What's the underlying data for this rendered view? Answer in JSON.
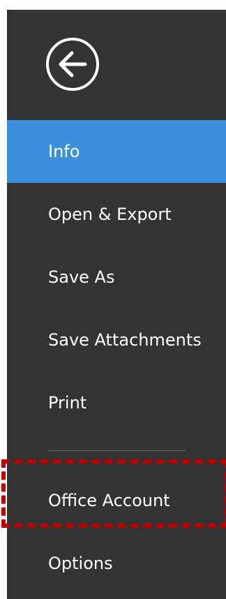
{
  "nav": {
    "back_icon": "back-arrow-circle-icon",
    "items": [
      {
        "label": "Info",
        "active": true
      },
      {
        "label": "Open & Export",
        "active": false
      },
      {
        "label": "Save As",
        "active": false
      },
      {
        "label": "Save Attachments",
        "active": false
      },
      {
        "label": "Print",
        "active": false
      },
      {
        "label": "Office Account",
        "active": false,
        "highlighted": true
      },
      {
        "label": "Options",
        "active": false
      }
    ]
  },
  "colors": {
    "sidebar_background": "#333333",
    "active_item": "#3b8fdd",
    "annotation_dash": "#c00000",
    "text": "#ffffff"
  }
}
